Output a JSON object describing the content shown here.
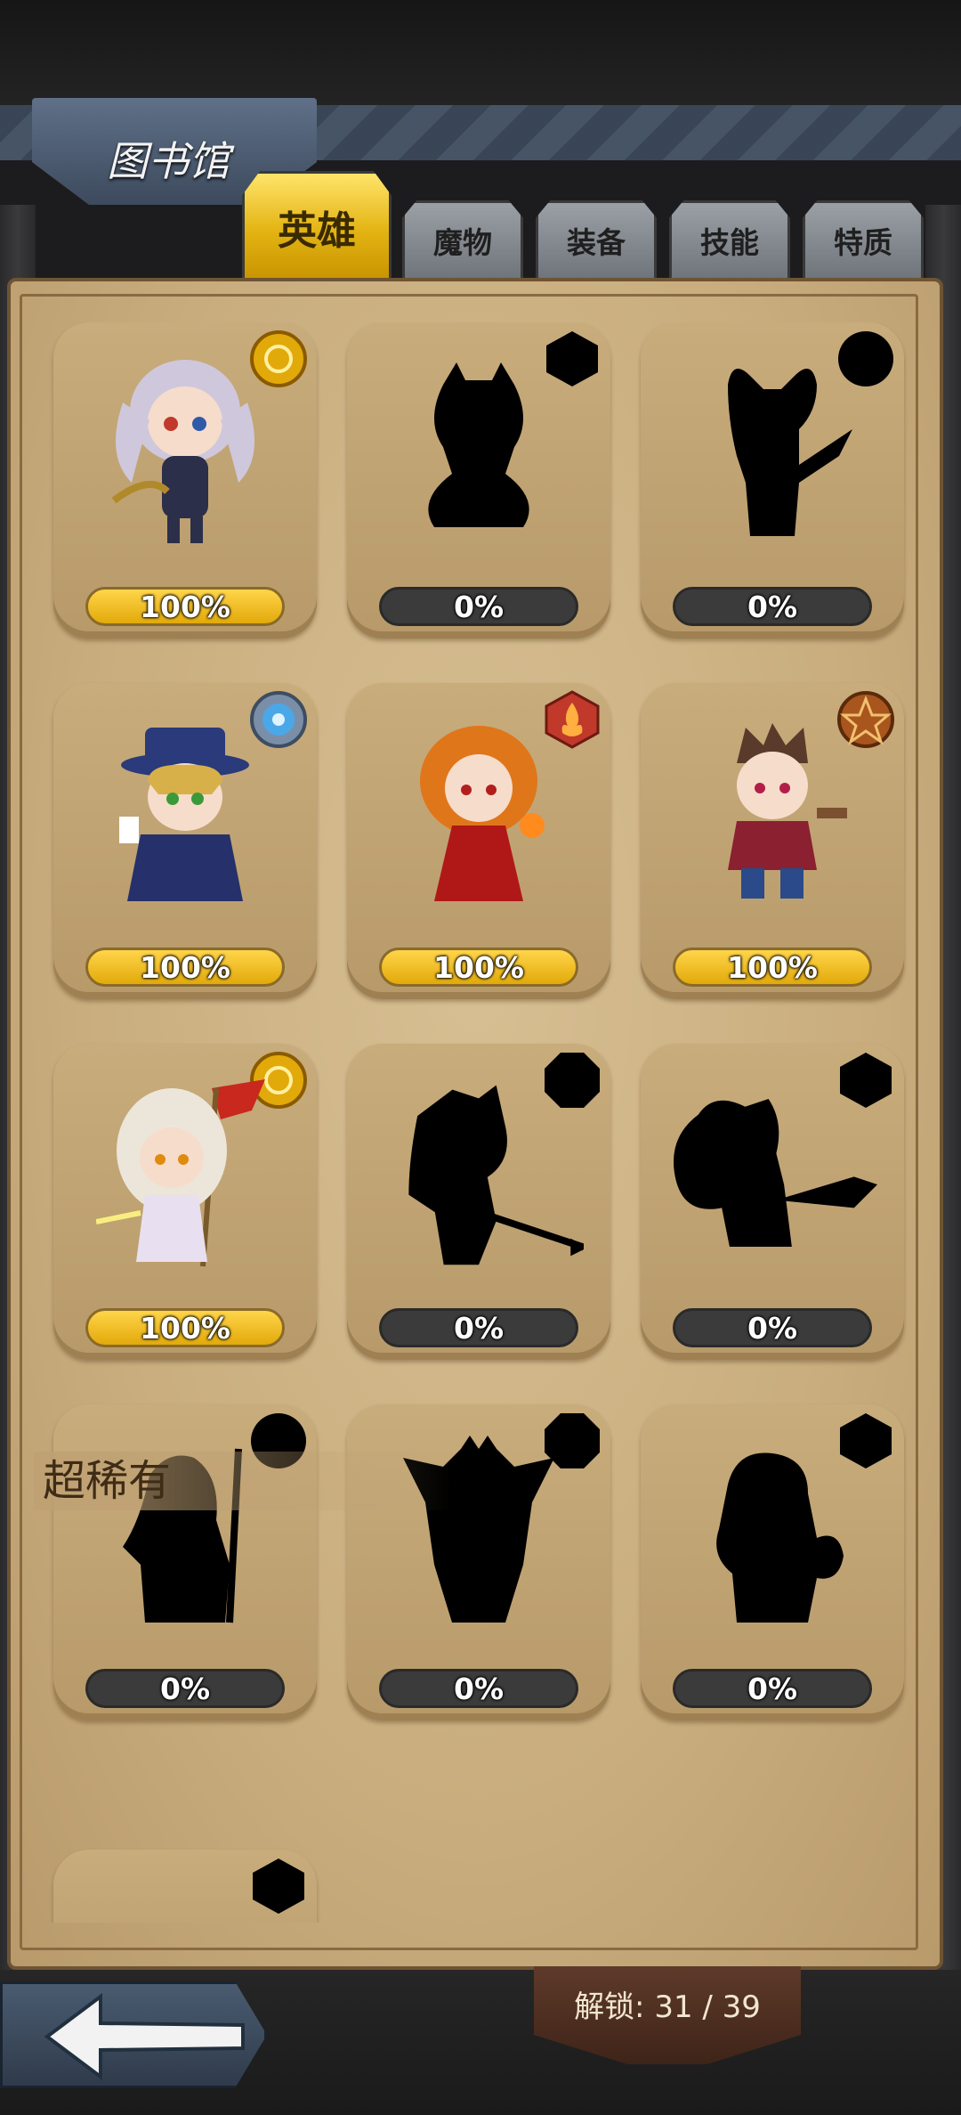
{
  "header": {
    "title": "图书馆"
  },
  "tabs": [
    {
      "label": "英雄",
      "active": true
    },
    {
      "label": "魔物",
      "active": false
    },
    {
      "label": "装备",
      "active": false
    },
    {
      "label": "技能",
      "active": false
    },
    {
      "label": "特质",
      "active": false
    }
  ],
  "cards": [
    {
      "progress": "100%",
      "unlocked": true,
      "badge": "gold-sun-icon"
    },
    {
      "progress": "0%",
      "unlocked": false,
      "badge": "hexagon-icon"
    },
    {
      "progress": "0%",
      "unlocked": false,
      "badge": "circle-icon"
    },
    {
      "progress": "100%",
      "unlocked": true,
      "badge": "blue-flower-icon"
    },
    {
      "progress": "100%",
      "unlocked": true,
      "badge": "fire-hexagon-icon"
    },
    {
      "progress": "100%",
      "unlocked": true,
      "badge": "orange-pentagram-icon"
    },
    {
      "progress": "100%",
      "unlocked": true,
      "badge": "gold-sun-icon"
    },
    {
      "progress": "0%",
      "unlocked": false,
      "badge": "octagon-icon"
    },
    {
      "progress": "0%",
      "unlocked": false,
      "badge": "hexagon-icon"
    },
    {
      "progress": "0%",
      "unlocked": false,
      "badge": "circle-icon"
    },
    {
      "progress": "0%",
      "unlocked": false,
      "badge": "octagon-icon"
    },
    {
      "progress": "0%",
      "unlocked": false,
      "badge": "hexagon-icon"
    }
  ],
  "section": {
    "title": "超稀有"
  },
  "footer": {
    "unlock_text": "解锁: 31 / 39"
  },
  "colors": {
    "accent_gold": "#e6b211",
    "parchment": "#c9ad7e",
    "tab_gray": "#8a9096",
    "bar_dark": "#3b3b3b"
  }
}
